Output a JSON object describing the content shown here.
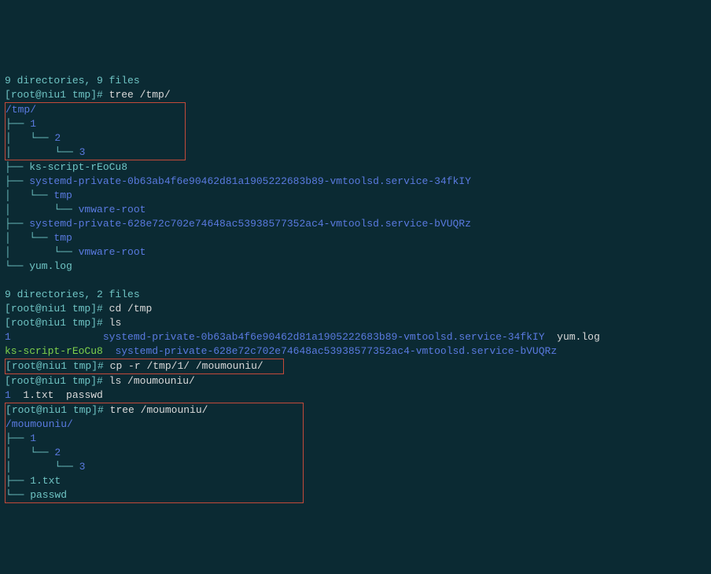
{
  "lines": {
    "top_partial": "9 directories, 9 files",
    "p1_bracket_open": "[",
    "p1_userhost": "root@niu1 tmp",
    "p1_bracket_close": "]# ",
    "p1_cmd": "tree /tmp/",
    "tree_tmp_root": "/tmp/",
    "tree_tmp_1": "├── 1",
    "tree_tmp_2": "│   └── 2",
    "tree_tmp_3": "│       └── 3",
    "tree_ks": "├── ks-script-rEoCu8",
    "tree_sys1": "├── systemd-private-0b63ab4f6e90462d81a1905222683b89-vmtoolsd.service-34fkIY",
    "tree_sys1t": "│   └── tmp",
    "tree_sys1v": "│       └── vmware-root",
    "tree_sys2": "├── systemd-private-628e72c702e74648ac53938577352ac4-vmtoolsd.service-bVUQRz",
    "tree_sys2t": "│   └── tmp",
    "tree_sys2v": "│       └── vmware-root",
    "tree_yum": "└── yum.log",
    "summary1": "9 directories, 2 files",
    "p2_cmd": "cd /tmp",
    "p3_cmd": "ls",
    "ls_1": "1",
    "ls_space1": "               ",
    "ls_sys1": "systemd-private-0b63ab4f6e90462d81a1905222683b89-vmtoolsd.service-34fkIY",
    "ls_sp_after_sys1": "  ",
    "ls_yum": "yum.log",
    "ls_ks": "ks-script-rEoCu8",
    "ls_space2": "  ",
    "ls_sys2": "systemd-private-628e72c702e74648ac53938577352ac4-vmtoolsd.service-bVUQRz",
    "p4_cmd": "cp -r /tmp/1/ /moumouniu/",
    "p5_cmd": "ls /moumouniu/",
    "ls2": "1  1.txt  passwd",
    "p6_cmd": "tree /moumouniu/",
    "tree2_root": "/moumouniu/",
    "tree2_1": "├── 1",
    "tree2_2": "│   └── 2",
    "tree2_3": "│       └── 3",
    "tree2_1txt": "├── 1.txt",
    "tree2_pw": "└── passwd"
  }
}
